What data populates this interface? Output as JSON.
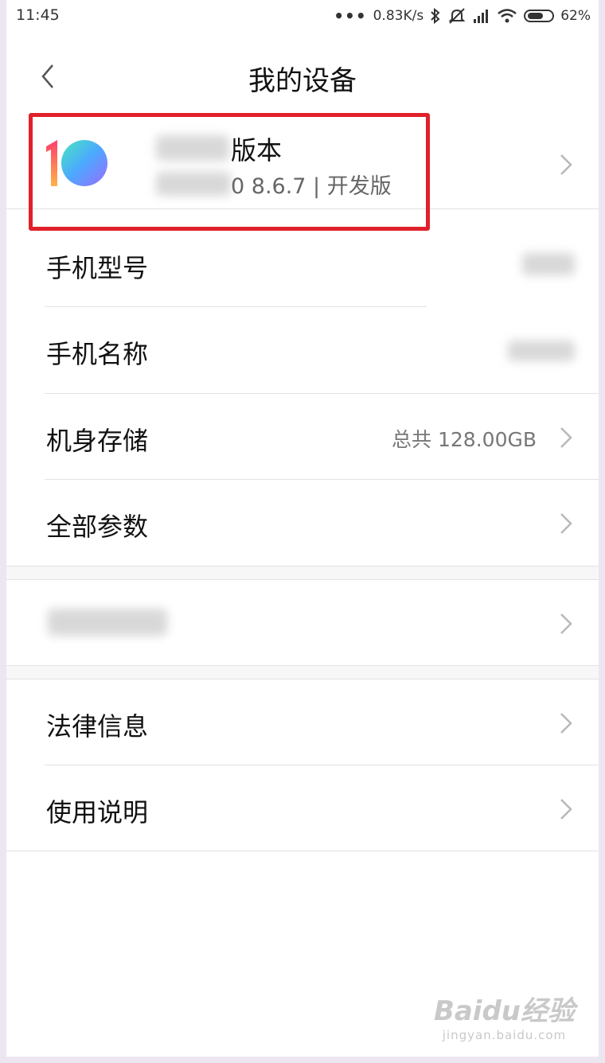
{
  "status_bar": {
    "time": "11:45",
    "network_speed": "0.83K/s",
    "battery_percent": "62%",
    "battery_level": 0.62,
    "icons": [
      "more-dots-icon",
      "bluetooth-icon",
      "mute-icon",
      "signal-icon",
      "wifi-icon",
      "battery-icon"
    ]
  },
  "header": {
    "title": "我的设备",
    "back_icon": "chevron-left-icon"
  },
  "version": {
    "title": "版本",
    "subtitle": "0 8.6.7 | 开发版",
    "logo_icon": "miui-10-logo"
  },
  "rows": [
    {
      "id": "phone-model",
      "label": "手机型号",
      "value": ""
    },
    {
      "id": "phone-name",
      "label": "手机名称",
      "value": ""
    },
    {
      "id": "storage",
      "label": "机身存储",
      "value": "总共 128.00GB"
    },
    {
      "id": "all-specs",
      "label": "全部参数",
      "value": ""
    }
  ],
  "rows2": [
    {
      "id": "legal",
      "label": "法律信息"
    },
    {
      "id": "manual",
      "label": "使用说明"
    }
  ],
  "watermark": {
    "main": "Baidu经验",
    "sub": "jingyan.baidu.com"
  },
  "colors": {
    "highlight": "#e0202a",
    "background": "#ffffff",
    "secondary_text": "#777777"
  }
}
